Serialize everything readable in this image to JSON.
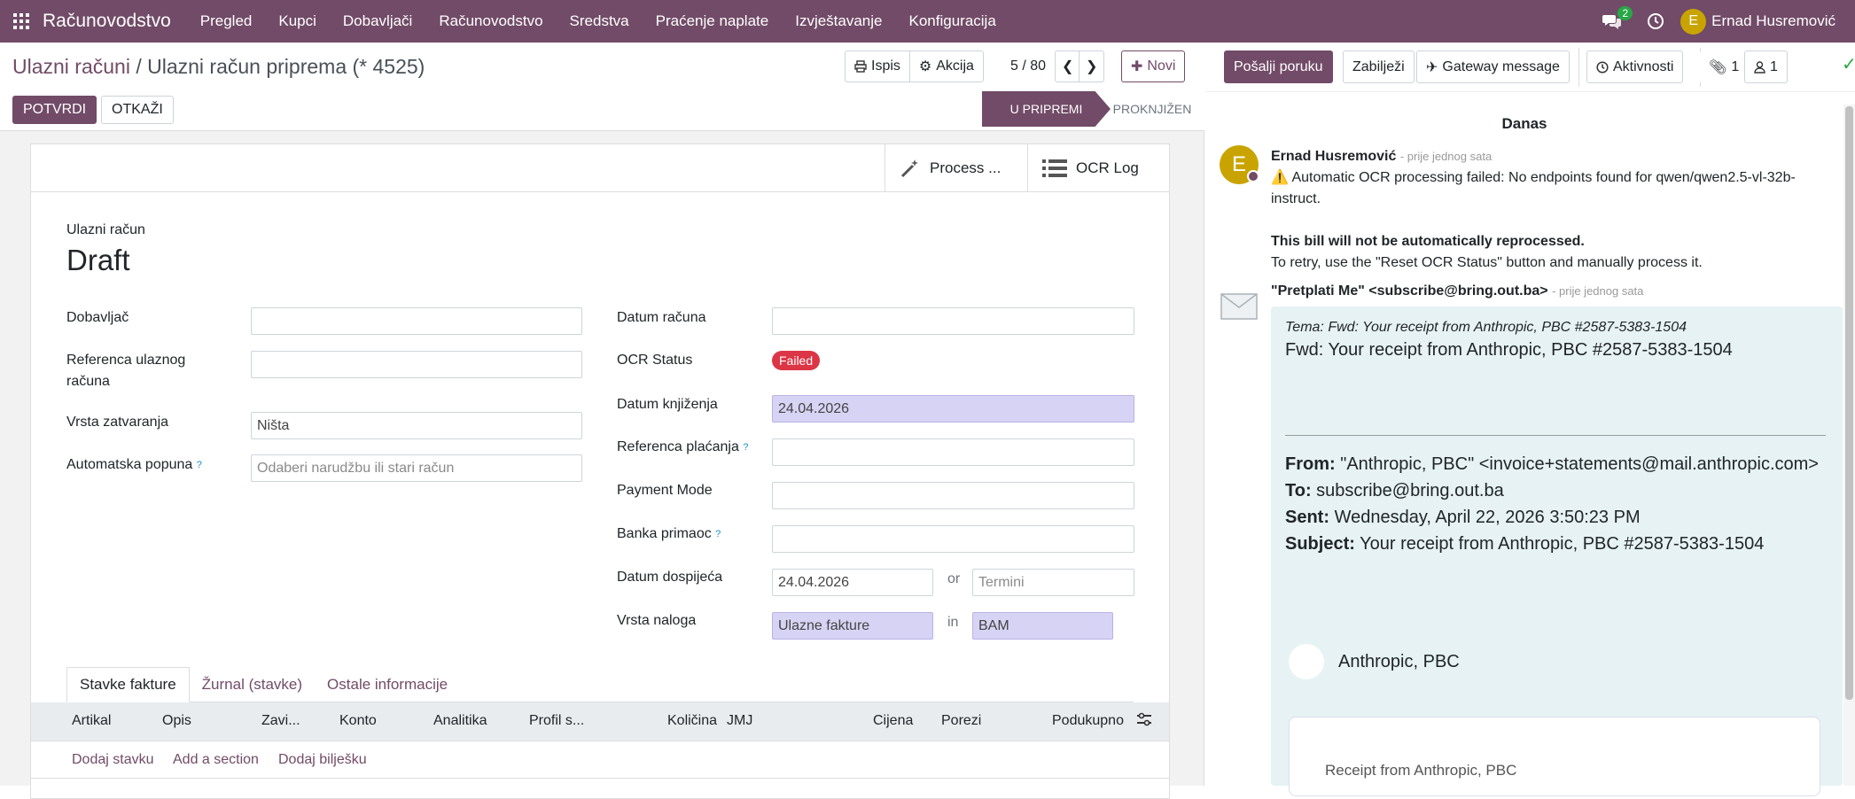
{
  "app": {
    "name": "Računovodstvo"
  },
  "nav": {
    "items": [
      "Pregled",
      "Kupci",
      "Dobavljači",
      "Računovodstvo",
      "Sredstva",
      "Praćenje naplate",
      "Izvještavanje",
      "Konfiguracija"
    ],
    "chat_badge": "2",
    "user_initial": "E",
    "user_name": "Ernad Husremović"
  },
  "breadcrumb": {
    "parent": "Ulazni računi",
    "sep": "/",
    "current": "Ulazni račun priprema (* 4525)"
  },
  "toolbar": {
    "print": "Ispis",
    "action": "Akcija",
    "pager": "5 / 80",
    "new": "Novi"
  },
  "status": {
    "confirm": "POTVRDI",
    "cancel": "OTKAŽI",
    "stages": [
      "U PRIPREMI",
      "PROKNJIŽEN"
    ],
    "active_stage": "U PRIPREMI"
  },
  "smart_buttons": {
    "process": "Process ...",
    "ocr_log": "OCR Log"
  },
  "form": {
    "type_label": "Ulazni račun",
    "title": "Draft",
    "vendor_label": "Dobavljač",
    "ref_label": "Referenca ulaznog računa",
    "closing_label": "Vrsta zatvaranja",
    "closing_value": "Ništa",
    "autofill_label": "Automatska popuna",
    "autofill_placeholder": "Odaberi narudžbu ili stari račun",
    "date_label": "Datum računa",
    "ocr_label": "OCR Status",
    "ocr_value": "Failed",
    "acc_date_label": "Datum knjiženja",
    "acc_date_value": "24.04.2026",
    "payref_label": "Referenca plaćanja",
    "paymode_label": "Payment Mode",
    "bank_label": "Banka primaoc",
    "due_label": "Datum dospijeća",
    "due_value": "24.04.2026",
    "or_text": "or",
    "terms_placeholder": "Termini",
    "journal_label": "Vrsta naloga",
    "journal_value": "Ulazne fakture",
    "in_text": "in",
    "currency_value": "BAM"
  },
  "tabs": [
    "Stavke fakture",
    "Žurnal (stavke)",
    "Ostale informacije"
  ],
  "table": {
    "headers": [
      "Artikal",
      "Opis",
      "Zavi...",
      "Konto",
      "Analitika",
      "Profil s...",
      "Količina",
      "JMJ",
      "Cijena",
      "Porezi",
      "Podukupno"
    ],
    "add_line": "Dodaj stavku",
    "add_section": "Add a section",
    "add_note": "Dodaj bilješku"
  },
  "chatter": {
    "send_message": "Pošalji poruku",
    "log_note": "Zabilježi",
    "gateway": "Gateway message",
    "activities": "Aktivnosti",
    "attachments": "1",
    "followers": "1",
    "day": "Danas",
    "msg1": {
      "author": "Ernad Husremović",
      "time": "- prije jednog sata",
      "avatar": "E",
      "line1": "⚠️ Automatic OCR processing failed: No endpoints found for qwen/qwen2.5-vl-32b-instruct.",
      "line2": "This bill will not be automatically reprocessed.",
      "line3": "To retry, use the \"Reset OCR Status\" button and manually process it."
    },
    "msg2": {
      "author": "\"Pretplati Me\" <subscribe@bring.out.ba>",
      "time": "- prije jednog sata",
      "subject_line": "Tema: Fwd: Your receipt from Anthropic, PBC #2587-5383-1504",
      "heading": "Fwd: Your receipt from Anthropic, PBC #2587-5383-1504",
      "from_label": "From:",
      "from_value": "\"Anthropic, PBC\" <invoice+statements@mail.anthropic.com>",
      "to_label": "To:",
      "to_value": "subscribe@bring.out.ba",
      "sent_label": "Sent:",
      "sent_value": "Wednesday, April 22, 2026 3:50:23 PM",
      "subj_label": "Subject:",
      "subj_value": "Your receipt from Anthropic, PBC #2587-5383-1504",
      "company": "Anthropic, PBC",
      "receipt_title": "Receipt from Anthropic, PBC"
    }
  },
  "colors": {
    "brand": "#714b67",
    "highlight": "#d7d3f4",
    "danger": "#dc3545",
    "bubble": "#e6f2f3"
  }
}
